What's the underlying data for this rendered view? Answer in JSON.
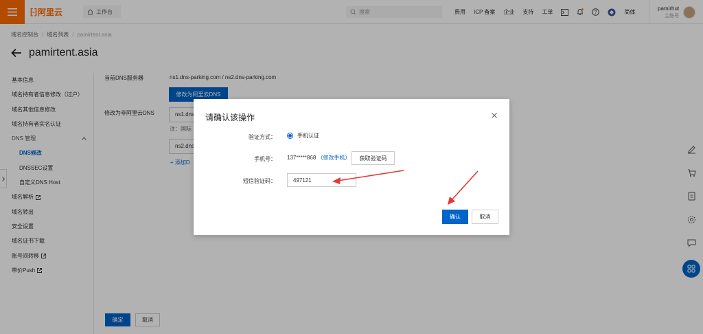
{
  "topbar": {
    "logo_text": "阿里云",
    "workbench": "工作台",
    "search_placeholder": "搜索",
    "nav": [
      "费用",
      "ICP 备案",
      "企业",
      "支持",
      "工单"
    ],
    "lang": "简体",
    "user_name": "pamirhut",
    "user_role": "主账号"
  },
  "breadcrumb": [
    "域名控制台",
    "域名列表",
    "pamirtent.asia"
  ],
  "page_title": "pamirtent.asia",
  "sidebar": {
    "items": [
      {
        "label": "基本信息"
      },
      {
        "label": "域名持有者信息修改（过户）"
      },
      {
        "label": "域名其他信息修改"
      },
      {
        "label": "域名持有者实名认证"
      },
      {
        "label": "DNS 管理"
      },
      {
        "label": "DNS修改"
      },
      {
        "label": "DNSSEC设置"
      },
      {
        "label": "自定义DNS Host"
      },
      {
        "label": "域名解析"
      },
      {
        "label": "域名转出"
      },
      {
        "label": "安全设置"
      },
      {
        "label": "域名证书下载"
      },
      {
        "label": "账号间转移"
      },
      {
        "label": "带价Push"
      }
    ]
  },
  "content": {
    "current_dns_label": "当前DNS服务器",
    "current_dns_value": "ns1.dns-parking.com / ns2.dns-parking.com",
    "switch_button": "修改为阿里云DNS",
    "non_aliyun_label": "修改为非阿里云DNS",
    "dns1_value": "ns1.dns",
    "note": "注：国际",
    "dns2_value": "ns2.dns",
    "add_link": "+ 添加D",
    "confirm_button": "确定",
    "cancel_button": "取消"
  },
  "modal": {
    "title": "请确认该操作",
    "method_label": "验证方式：",
    "method_value": "手机认证",
    "phone_label": "手机号：",
    "phone_value": "137*****868",
    "change_phone": "（修改手机）",
    "get_code_button": "获取验证码",
    "sms_label": "短信验证码：",
    "sms_value": "497121",
    "ok_button": "确认",
    "cancel_button": "取消"
  },
  "colors": {
    "brand": "#ff6a00",
    "primary": "#0064c8",
    "annotation_arrow": "#e53935"
  }
}
